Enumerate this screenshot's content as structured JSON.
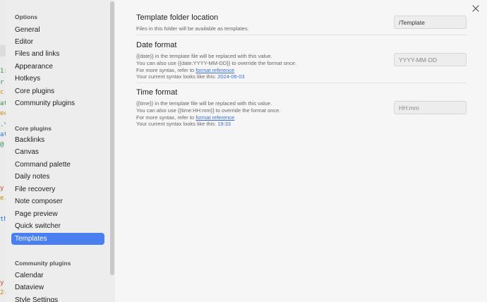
{
  "sidebar": {
    "options_title": "Options",
    "options_items": [
      {
        "label": "General"
      },
      {
        "label": "Editor"
      },
      {
        "label": "Files and links"
      },
      {
        "label": "Appearance"
      },
      {
        "label": "Hotkeys"
      },
      {
        "label": "Core plugins"
      },
      {
        "label": "Community plugins"
      }
    ],
    "core_title": "Core plugins",
    "core_items": [
      {
        "label": "Backlinks"
      },
      {
        "label": "Canvas"
      },
      {
        "label": "Command palette"
      },
      {
        "label": "Daily notes"
      },
      {
        "label": "File recovery"
      },
      {
        "label": "Note composer"
      },
      {
        "label": "Page preview"
      },
      {
        "label": "Quick switcher"
      },
      {
        "label": "Templates",
        "active": true
      }
    ],
    "community_title": "Community plugins",
    "community_items": [
      {
        "label": "Calendar"
      },
      {
        "label": "Dataview"
      },
      {
        "label": "Style Settings"
      }
    ]
  },
  "main": {
    "close_icon": "close-icon",
    "folder": {
      "name": "Template folder location",
      "desc": "Files in this folder will be available as templates.",
      "value": "/Template"
    },
    "date": {
      "name": "Date format",
      "line1": "{{date}} in the template file will be replaced with this value.",
      "line2": "You can also use {{date:YYYY-MM-DD}} to override the format once.",
      "syntax_prefix": "For more syntax, refer to ",
      "syntax_link": "format reference",
      "current_prefix": "Your current syntax looks like this: ",
      "current_value": "2024-06-03",
      "placeholder": "YYYY-MM-DD"
    },
    "time": {
      "name": "Time format",
      "line1": "{{time}} in the template file will be replaced with this value.",
      "line2": "You can also use {{time:HH:mm}} to override the format once.",
      "syntax_prefix": "For more syntax, refer to ",
      "syntax_link": "format reference",
      "current_prefix": "Your current syntax looks like this: ",
      "current_value": "19:33",
      "placeholder": "HH:mm"
    }
  },
  "colors": {
    "accent": "#4a7ff0",
    "link": "#3b6fd4"
  }
}
